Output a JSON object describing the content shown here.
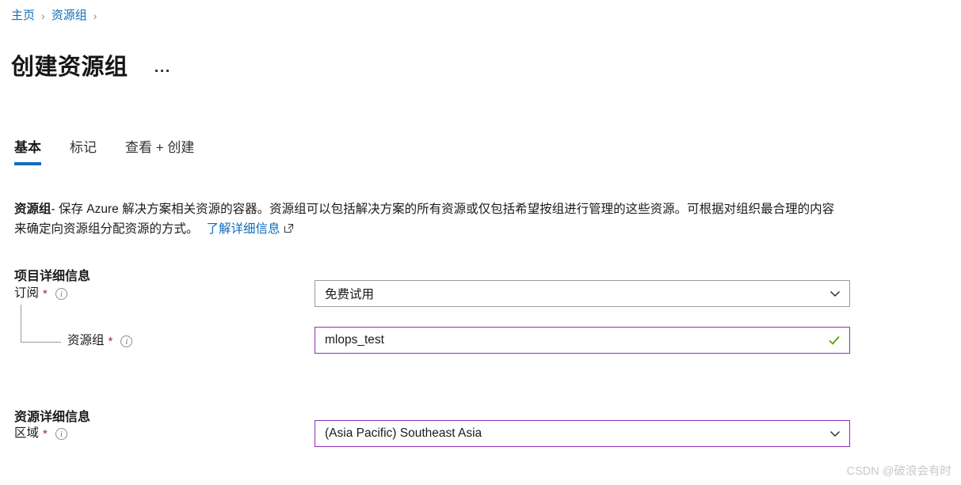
{
  "breadcrumb": {
    "items": [
      {
        "label": "主页"
      },
      {
        "label": "资源组"
      }
    ],
    "separator": "›"
  },
  "header": {
    "title": "创建资源组",
    "more_actions_name": "more-actions"
  },
  "tabs": [
    {
      "label": "基本",
      "active": true
    },
    {
      "label": "标记",
      "active": false
    },
    {
      "label": "查看 + 创建",
      "active": false
    }
  ],
  "description": {
    "bold_lead": "资源组",
    "body": "- 保存 Azure 解决方案相关资源的容器。资源组可以包括解决方案的所有资源或仅包括希望按组进行管理的这些资源。可根据对组织最合理的内容来确定向资源组分配资源的方式。",
    "link_label": "了解详细信息"
  },
  "sections": {
    "project_details": {
      "heading": "项目详细信息",
      "fields": {
        "subscription": {
          "label": "订阅",
          "required_mark": "*",
          "value": "免费试用"
        },
        "resource_group": {
          "label": "资源组",
          "required_mark": "*",
          "value": "mlops_test",
          "placeholder": ""
        }
      }
    },
    "resource_details": {
      "heading": "资源详细信息",
      "fields": {
        "region": {
          "label": "区域",
          "required_mark": "*",
          "value": "(Asia Pacific) Southeast Asia"
        }
      }
    }
  },
  "watermark": "CSDN @破浪会有时",
  "colors": {
    "link_blue": "#0f6cbd",
    "tab_underline": "#0f6cbd",
    "required_star": "#a4262c",
    "focus_border_purple": "#8b2fb8",
    "valid_check_green": "#5ca000",
    "border_gray": "#9a9a9a"
  }
}
